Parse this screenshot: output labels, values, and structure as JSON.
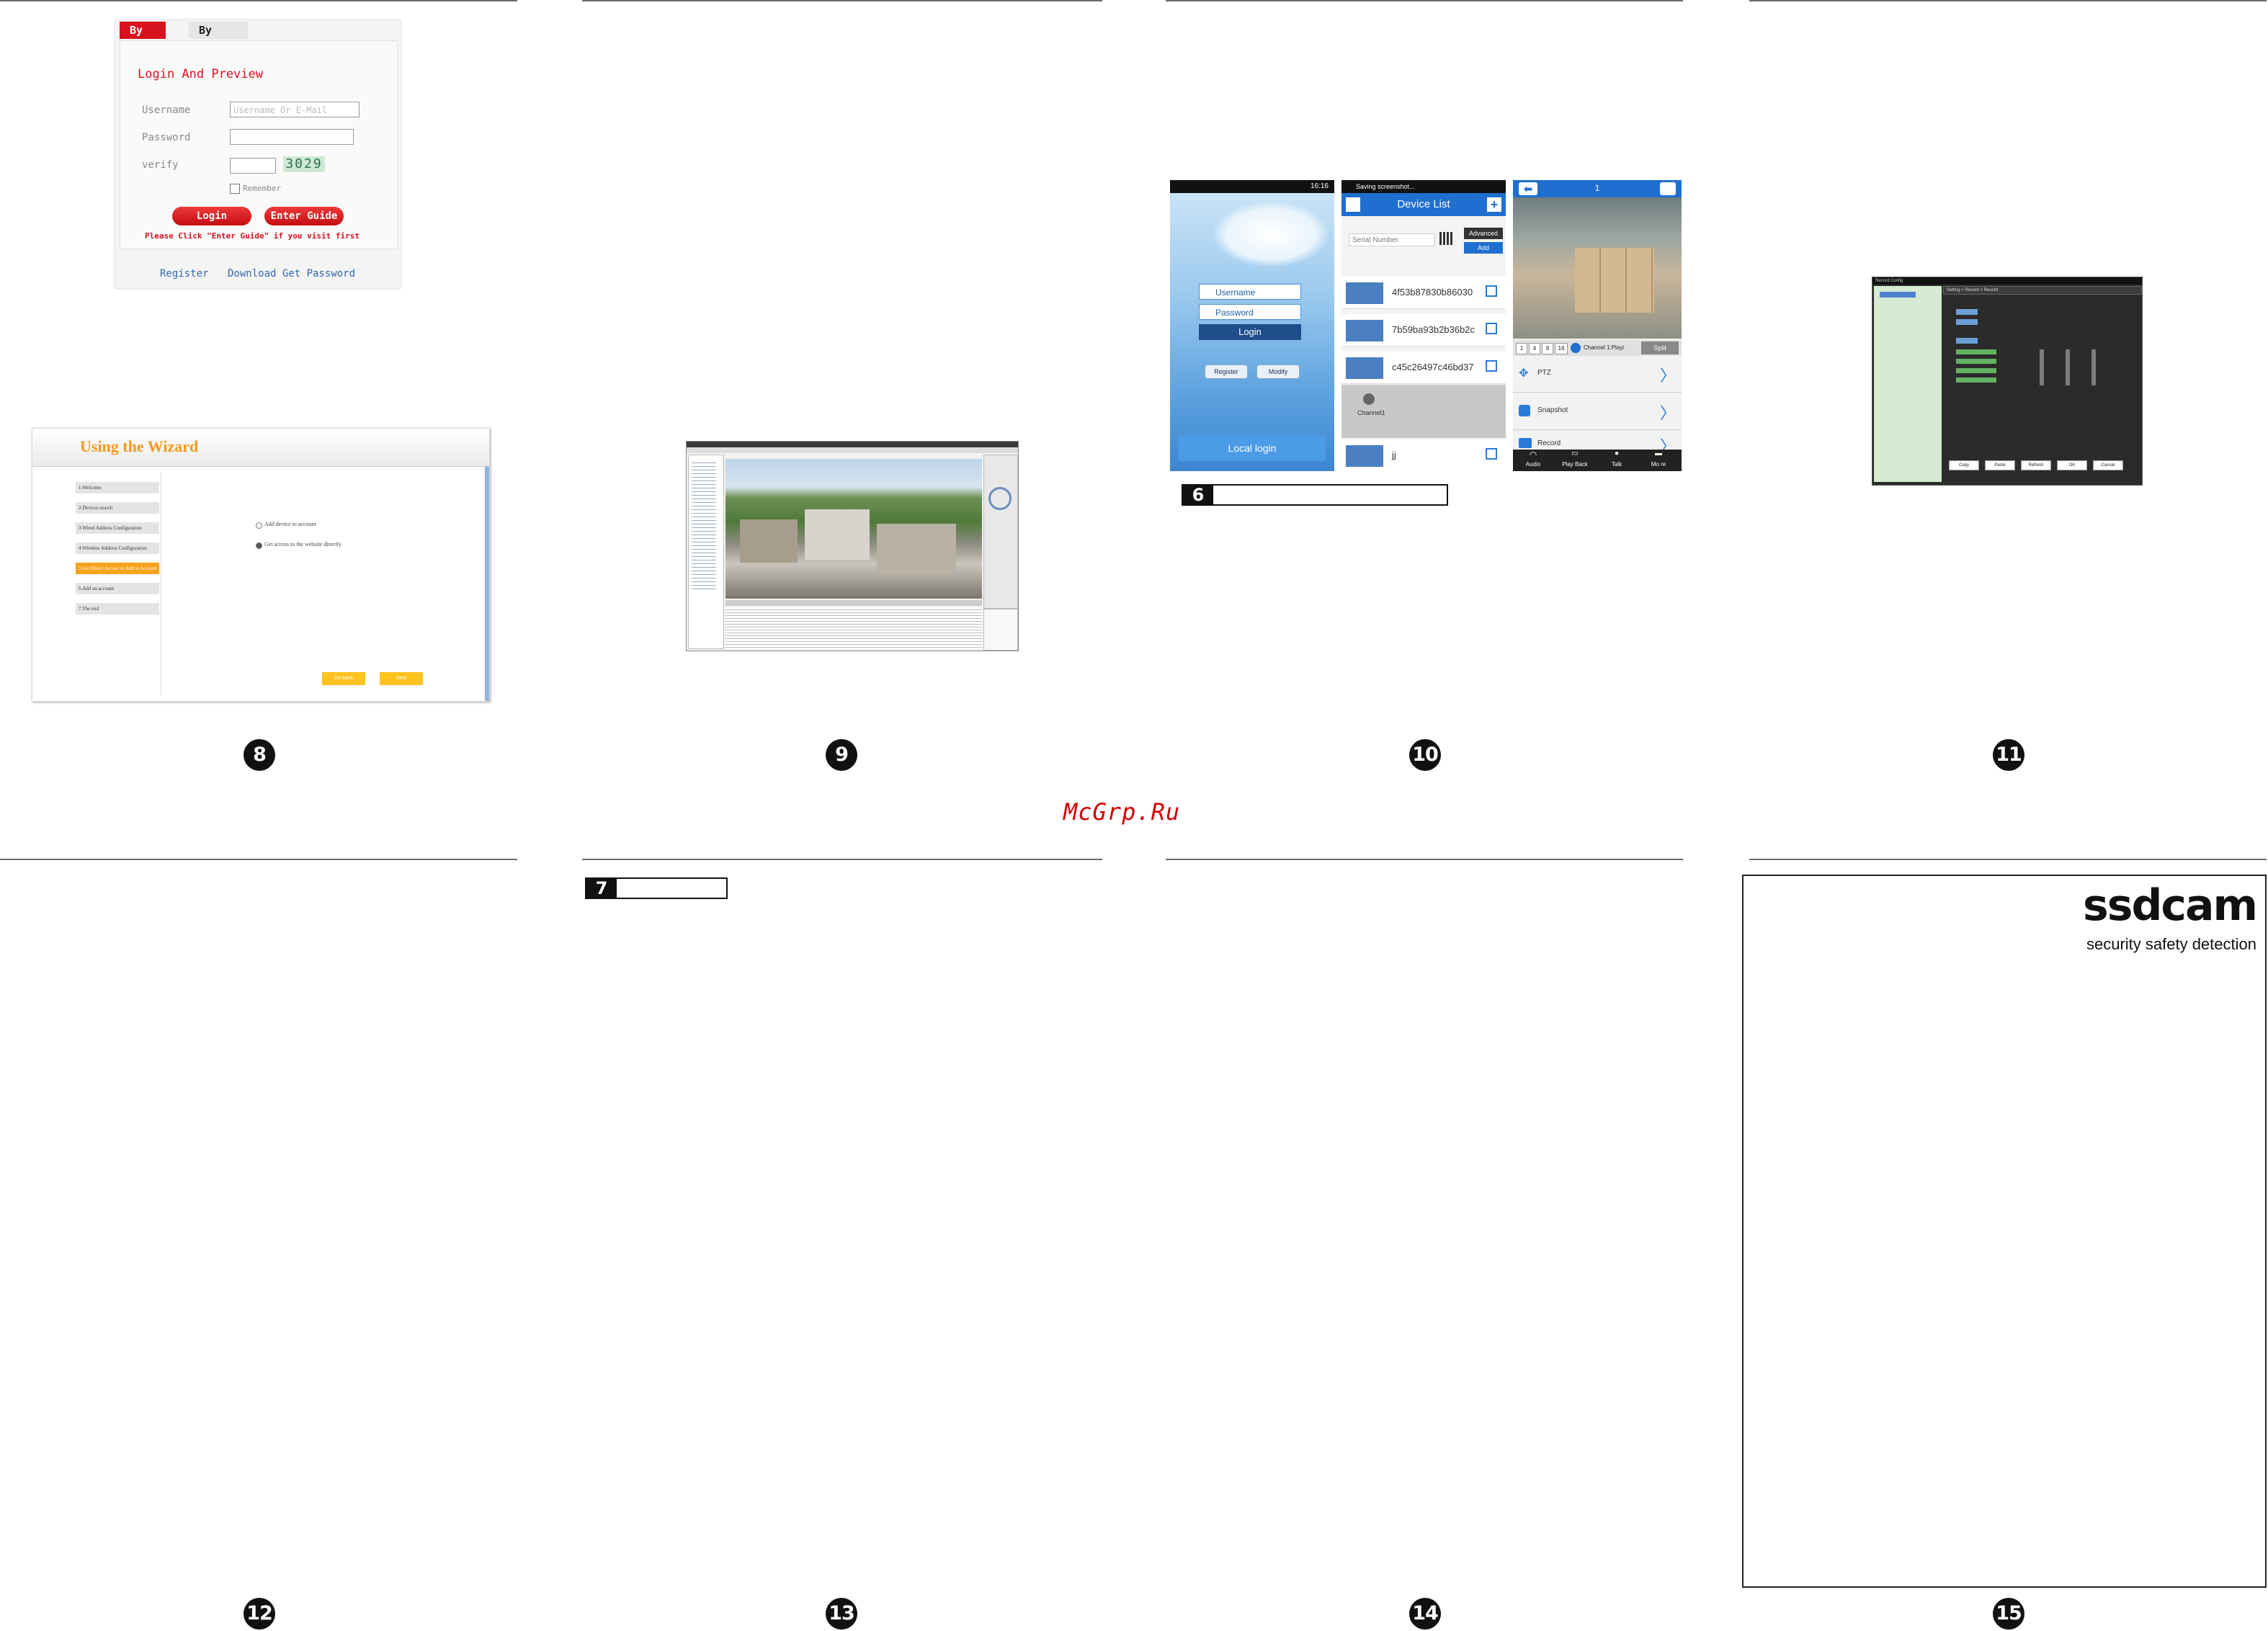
{
  "login": {
    "tab_user": "By User",
    "tab_device": "By Device",
    "title": "Login And Preview",
    "username_label": "Username",
    "username_placeholder": "Username Or E-Mail",
    "password_label": "Password",
    "verify_label": "verify",
    "captcha": "3029",
    "remember_label": "Remember",
    "login_button": "Login",
    "guide_button": "Enter Guide",
    "notice": "Please Click \"Enter Guide\" if you visit first",
    "register_link": "Register",
    "download_link": "Download Get Password"
  },
  "wizard": {
    "title": "Using the Wizard",
    "steps": [
      "1.Welcome",
      "2.Devices search",
      "3.Wired Address Configuration",
      "4.Wireless Address Configuration",
      "5.Get Direct Access or Add to Account",
      "6.Add an account",
      "7.The end"
    ],
    "option_1": "Add device to account",
    "option_2": "Get access to the website directly",
    "back_button": "Go back",
    "next_button": "Next"
  },
  "phone_login": {
    "time": "16:16",
    "username_placeholder": "Username",
    "password_placeholder": "Password",
    "login_button": "Login",
    "register_button": "Register",
    "modify_button": "Modify",
    "local_login": "Local login"
  },
  "device_list": {
    "status": "Saving screenshot...",
    "title": "Device List",
    "serial_placeholder": "Serial Number",
    "advanced_button": "Advanced",
    "add_button": "Add",
    "devices": [
      "4f53b87830b86030",
      "7b59ba93b2b36b2c",
      "c45c26497c46bd37"
    ],
    "channel_label": "Channel1",
    "last_device": "jj"
  },
  "live_view": {
    "page": "1",
    "channel_buttons": [
      "1",
      "4",
      "9",
      "16"
    ],
    "channel_status": "Channel 1:Playi",
    "split_button": "Split",
    "menu": [
      "PTZ",
      "Snapshot",
      "Record"
    ],
    "bottom_bar": [
      "Audio",
      "Play Back",
      "Talk",
      "Mo re"
    ]
  },
  "setting_window": {
    "title": "Record Config",
    "breadcrumb": "Setting > Record > Record",
    "buttons": [
      "Copy",
      "Paste",
      "Refresh",
      "OK",
      "Cancel"
    ]
  },
  "section_6": "6",
  "section_7": "7",
  "page_numbers": [
    "8",
    "9",
    "10",
    "11",
    "12",
    "13",
    "14",
    "15"
  ],
  "watermark": "McGrp.Ru",
  "brand": {
    "logo": "ssdcam",
    "tagline": "security safety detection"
  }
}
